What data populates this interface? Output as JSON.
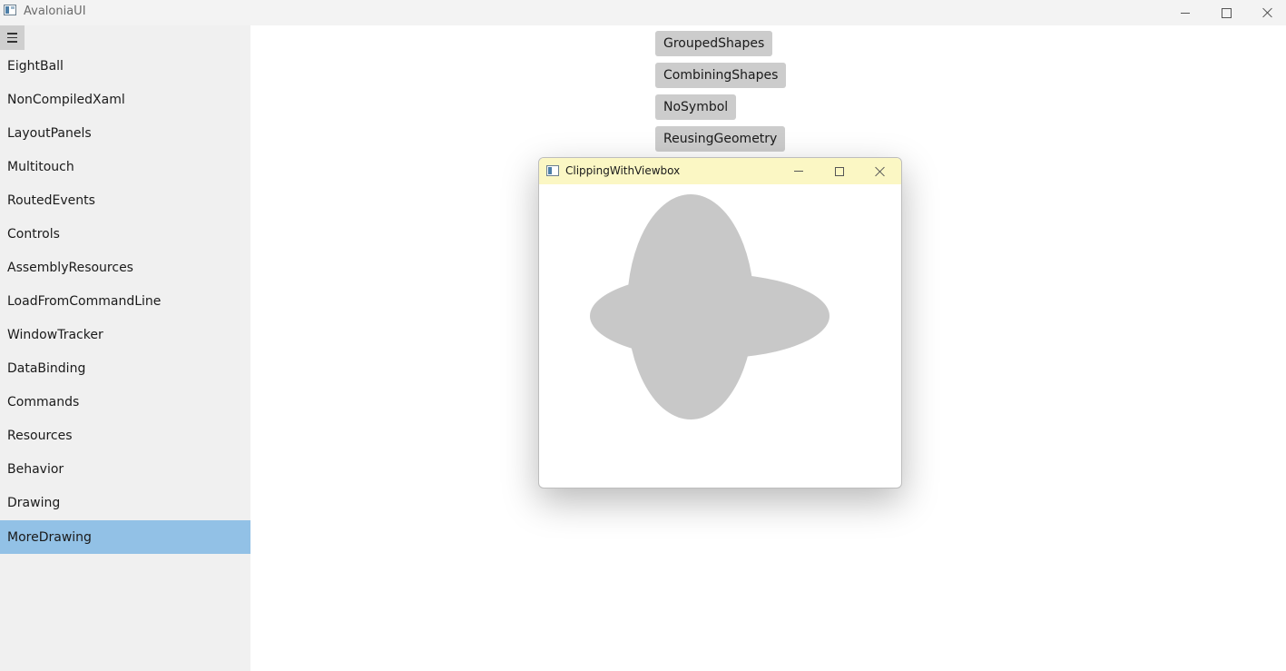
{
  "window": {
    "title": "AvaloniaUI",
    "icon": "app-window-icon",
    "controls": [
      "minimize-icon",
      "maximize-icon",
      "close-icon"
    ]
  },
  "sidebar": {
    "toggle_icon": "hamburger-icon",
    "items": [
      {
        "label": "EightBall"
      },
      {
        "label": "NonCompiledXaml"
      },
      {
        "label": "LayoutPanels"
      },
      {
        "label": "Multitouch"
      },
      {
        "label": "RoutedEvents"
      },
      {
        "label": "Controls"
      },
      {
        "label": "AssemblyResources"
      },
      {
        "label": "LoadFromCommandLine"
      },
      {
        "label": "WindowTracker"
      },
      {
        "label": "DataBinding"
      },
      {
        "label": "Commands"
      },
      {
        "label": "Resources"
      },
      {
        "label": "Behavior"
      },
      {
        "label": "Drawing"
      },
      {
        "label": "MoreDrawing"
      }
    ],
    "selected": "MoreDrawing",
    "selected_color": "#92c1e6"
  },
  "content": {
    "buttons": [
      {
        "label": "GroupedShapes"
      },
      {
        "label": "CombiningShapes"
      },
      {
        "label": "NoSymbol"
      },
      {
        "label": "ReusingGeometry"
      }
    ]
  },
  "child_window": {
    "title": "ClippingWithViewbox",
    "titlebar_color": "#fbf7c4",
    "shape_color": "#c8c8c8"
  }
}
